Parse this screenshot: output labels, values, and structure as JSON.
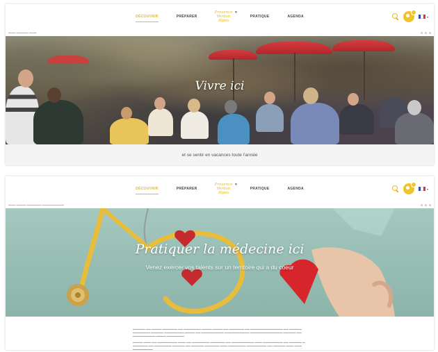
{
  "nav": {
    "items": [
      {
        "label": "DÉCOUVRIR",
        "active": true
      },
      {
        "label": "PRÉPARER",
        "active": false
      },
      {
        "label": "PRATIQUE",
        "active": false
      },
      {
        "label": "AGENDA",
        "active": false
      }
    ],
    "logo_lines": [
      "Provence",
      "Verdon",
      "Alpes"
    ],
    "accent_color": "#e8b923",
    "icons": [
      "search-icon",
      "account-icon",
      "french-flag-icon"
    ]
  },
  "page1": {
    "hero_title": "Vivre ici",
    "tagline": "et se sentir en vacances toute l'année"
  },
  "page2": {
    "hero_title": "Pratiquer la médecine ici",
    "hero_subtitle": "Venez exercer vos talents sur un territoire qui a du coeur"
  }
}
